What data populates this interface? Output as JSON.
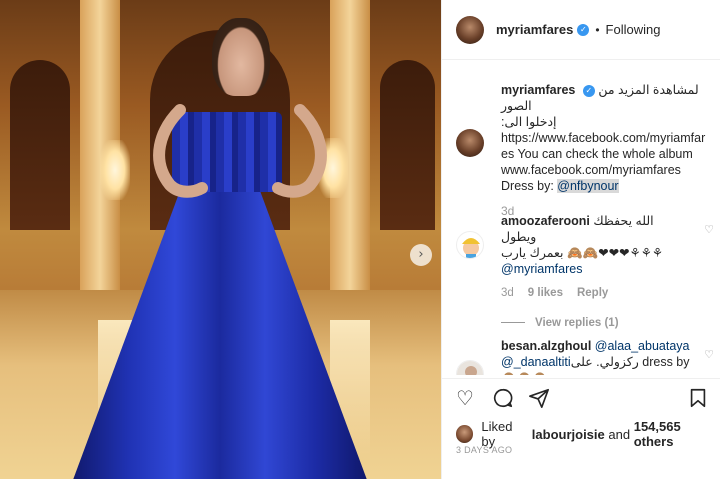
{
  "post": {
    "carousel_next_icon": "chevron-right-icon"
  },
  "header": {
    "username": "myriamfares",
    "verified_icon": "verified-badge-icon",
    "separator": "•",
    "follow_state": "Following"
  },
  "caption": {
    "username": "myriamfares",
    "line1": "لمشاهدة المزيد من الصور",
    "line2": "إدخلوا الى:",
    "line3": "https://www.facebook.com/myriamfar",
    "line4": "es You can check the whole album",
    "line5": "www.facebook.com/myriamfares",
    "dress_prefix": "Dress by: ",
    "dress_mention": "@nfbynour",
    "age": "3d"
  },
  "comments": [
    {
      "username": "amoozaferooni",
      "text_line1": "الله يحفظك ويطول",
      "text_line2": "بعمرك يارب 🙈🙈❤❤❤⚘⚘⚘",
      "mention": "@myriamfares",
      "age": "3d",
      "likes": "9 likes",
      "reply": "Reply",
      "view_replies": "View replies (1)"
    },
    {
      "username": "besan.alzghoul",
      "mention1": "@alaa_abuataya",
      "mention2": "@_danaaltiti",
      "text": "ركزولي. على dress by",
      "text_line3": "🙈🙈🙈"
    }
  ],
  "actions": {
    "like_icon": "heart-icon",
    "comment_icon": "comment-icon",
    "share_icon": "share-icon",
    "save_icon": "bookmark-icon",
    "liked_by_prefix": "Liked by ",
    "liked_by_user": "labourjoisie",
    "liked_by_and": " and ",
    "liked_by_count": "154,565 others",
    "time_ago": "3 DAYS AGO"
  }
}
